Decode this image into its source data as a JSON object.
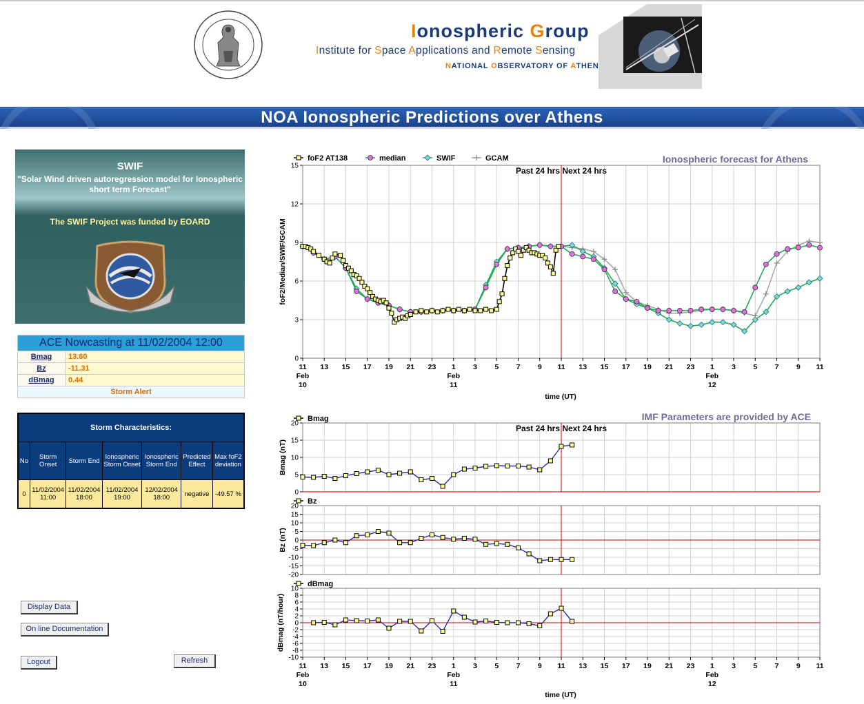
{
  "header": {
    "title_first": "I",
    "title_rest_1": "onospheric ",
    "title_second": "G",
    "title_rest_2": "roup",
    "sub_1": "I",
    "sub_2": "nstitute for ",
    "sub_3": "S",
    "sub_4": "pace ",
    "sub_5": "A",
    "sub_6": "pplications and ",
    "sub_7": "R",
    "sub_8": "emote ",
    "sub_9": "S",
    "sub_10": "ensing",
    "noa_1": "N",
    "noa_2": "ATIONAL ",
    "noa_3": "O",
    "noa_4": "BSERVATORY OF ",
    "noa_5": "A",
    "noa_6": "THENS",
    "seal_text": "ΕΘΝΙΚΟΝ ΑΣΤΕΡΟΣΚΟΠΕΙΟΝ ΑΘΗΝΩΝ · NATIONAL OBSERVATORY ATHENS"
  },
  "banner": {
    "title": "NOA Ionospheric Predictions over Athens"
  },
  "swif": {
    "title": "SWIF",
    "subtitle_1": "\"Solar Wind driven autoregression model for Ionospheric",
    "subtitle_2": "short term Forecast\"",
    "funded": "The SWIF Project was funded by EOARD",
    "badge_text": "EUROPEAN OFFICE AEROSPACE R&D"
  },
  "ace": {
    "title": "ACE Nowcasting at 11/02/2004 12:00",
    "rows": [
      {
        "key": "Bmag",
        "value": "13.60"
      },
      {
        "key": "Bz",
        "value": "-11.31"
      },
      {
        "key": "dBmag",
        "value": "0.44"
      }
    ],
    "alert": "Storm Alert"
  },
  "storm": {
    "title": "Storm Characteristics:",
    "headers": [
      "No",
      "Storm Onset",
      "Storm End",
      "Ionospheric Storm Onset",
      "Ionospheric Storm End",
      "Predicted Effect",
      "Max foF2 deviation"
    ],
    "row": [
      "0",
      "11/02/2004 11:00",
      "11/02/2004 18:00",
      "11/02/2004 19:00",
      "12/02/2004 18:00",
      "negative",
      "-49.57 %"
    ]
  },
  "buttons": {
    "display_data": "Display Data",
    "online_doc": "On line Documentation",
    "logout": "Logout",
    "refresh": "Refresh"
  },
  "colors": {
    "banner": "#1f4f9e",
    "ace_head": "#2c9fd9",
    "storm_head": "#0b3d7e",
    "storm_cell": "#fce99c",
    "chart_title": "#6b6b9a",
    "median": "#e070e0",
    "swif": "#22aa55",
    "gcam": "#a8a8a8",
    "imf_line": "#2c2cb4",
    "now_line": "#cc0000"
  },
  "chart_data": [
    {
      "type": "line",
      "title": "Ionospheric forecast for Athens",
      "ylabel": "foF2/Median/SWIF/GCAM",
      "xlabel": "time (UT)",
      "annotation": "Past 24 hrs Next 24 hrs",
      "ylim": [
        0,
        15
      ],
      "yticks": [
        "0",
        "3",
        "6",
        "9",
        "12",
        "15"
      ],
      "xticks": [
        "11",
        "13",
        "15",
        "17",
        "19",
        "21",
        "23",
        "1",
        "3",
        "5",
        "7",
        "9",
        "11",
        "13",
        "15",
        "17",
        "19",
        "21",
        "23",
        "1",
        "3",
        "5",
        "7",
        "9",
        "11"
      ],
      "date_labels": [
        {
          "month": "Feb",
          "day": "10"
        },
        {
          "month": "Feb",
          "day": "11"
        },
        {
          "month": "Feb",
          "day": "12"
        }
      ],
      "grid": true,
      "legend": "top-left",
      "x_range_hours": [
        0,
        48
      ],
      "now_hour": 24,
      "series": [
        {
          "name": "foF2 AT138",
          "x": [
            0,
            0.25,
            0.5,
            0.75,
            1,
            1.5,
            2,
            2.25,
            2.5,
            2.75,
            3,
            3.5,
            3.75,
            4,
            4.25,
            4.5,
            4.75,
            5,
            5.25,
            5.5,
            5.75,
            6,
            6.25,
            6.5,
            6.75,
            7,
            7.25,
            7.5,
            7.75,
            8,
            8.25,
            8.5,
            8.75,
            9,
            9.25,
            9.5,
            9.75,
            10,
            10.5,
            11,
            11.5,
            12,
            12.5,
            13,
            13.5,
            14,
            14.5,
            15,
            15.5,
            16,
            16.5,
            17,
            17.5,
            18,
            18.25,
            18.5,
            18.75,
            19,
            19.25,
            19.5,
            19.75,
            20,
            20.25,
            20.5,
            20.75,
            21,
            21.25,
            21.5,
            21.75,
            22,
            22.25,
            22.5,
            22.75,
            23,
            23.25,
            23.5,
            23.75
          ],
          "values": [
            8.7,
            8.7,
            8.6,
            8.5,
            8.3,
            8.0,
            7.7,
            7.5,
            7.4,
            7.8,
            8.1,
            8.0,
            7.6,
            7.2,
            7.0,
            6.8,
            6.5,
            6.4,
            6.2,
            5.9,
            5.6,
            5.4,
            5.1,
            4.8,
            4.6,
            4.5,
            4.4,
            4.5,
            4.3,
            3.9,
            3.5,
            2.8,
            3.0,
            3.1,
            3.2,
            3.1,
            3.3,
            3.4,
            3.6,
            3.7,
            3.6,
            3.7,
            3.6,
            3.7,
            3.8,
            3.7,
            3.8,
            3.7,
            3.8,
            3.7,
            3.7,
            3.8,
            3.7,
            3.8,
            4.4,
            5.0,
            6.2,
            7.2,
            7.8,
            8.2,
            8.5,
            8.3,
            8.0,
            8.4,
            8.6,
            8.4,
            8.2,
            8.2,
            8.1,
            8.0,
            8.0,
            7.8,
            7.4,
            7.1,
            6.6,
            8.4,
            8.7
          ]
        },
        {
          "name": "median",
          "x": [
            0,
            1,
            2,
            3,
            4,
            5,
            6,
            7,
            8,
            9,
            10,
            11,
            12,
            13,
            14,
            15,
            16,
            17,
            18,
            19,
            20,
            21,
            22,
            23,
            24,
            25,
            26,
            27,
            28,
            29,
            30,
            31,
            32,
            33,
            34,
            35,
            36,
            37,
            38,
            39,
            40,
            41,
            42,
            43,
            44,
            45,
            46,
            47,
            48
          ],
          "values": [
            8.7,
            8.2,
            7.7,
            7.9,
            7.0,
            5.2,
            4.6,
            4.3,
            4.1,
            3.8,
            3.6,
            3.6,
            3.7,
            3.7,
            3.7,
            3.7,
            3.8,
            5.5,
            7.3,
            8.5,
            8.6,
            8.7,
            8.8,
            8.7,
            8.7,
            8.1,
            7.9,
            7.7,
            6.9,
            5.2,
            4.6,
            4.4,
            3.9,
            3.7,
            3.7,
            3.7,
            3.7,
            3.8,
            3.8,
            3.8,
            3.7,
            3.6,
            5.5,
            7.3,
            8.1,
            8.5,
            8.6,
            8.8,
            8.6
          ]
        },
        {
          "name": "SWIF",
          "x": [
            0,
            1,
            2,
            3,
            4,
            5,
            6,
            7,
            8,
            9,
            10,
            11,
            12,
            13,
            14,
            15,
            16,
            17,
            18,
            19,
            20,
            21,
            22,
            23,
            24,
            25,
            26,
            27,
            28,
            29,
            30,
            31,
            32,
            33,
            34,
            35,
            36,
            37,
            38,
            39,
            40,
            41,
            42,
            43,
            44,
            45,
            46,
            47,
            48
          ],
          "values": [
            8.7,
            8.2,
            7.7,
            7.9,
            7.0,
            5.4,
            4.6,
            4.4,
            4.1,
            3.8,
            3.6,
            3.6,
            3.7,
            3.7,
            3.7,
            3.7,
            3.8,
            5.7,
            7.5,
            8.5,
            8.6,
            8.7,
            8.8,
            8.7,
            8.7,
            8.8,
            8.3,
            7.9,
            7.0,
            5.8,
            4.6,
            4.2,
            3.9,
            3.5,
            3.0,
            2.7,
            2.5,
            2.6,
            2.8,
            2.8,
            2.6,
            2.1,
            3.0,
            3.6,
            4.8,
            5.2,
            5.5,
            5.9,
            6.2
          ]
        },
        {
          "name": "GCAM",
          "x": [
            22,
            23,
            24,
            25,
            26,
            27,
            28,
            29,
            30,
            31,
            32,
            33,
            34,
            35,
            36,
            37,
            38,
            39,
            40,
            41,
            42,
            43,
            44,
            45,
            46,
            47,
            48
          ],
          "values": [
            8.8,
            8.7,
            8.7,
            8.6,
            8.5,
            8.3,
            7.7,
            6.9,
            5.1,
            4.4,
            4.1,
            3.8,
            3.5,
            3.5,
            3.6,
            3.7,
            3.8,
            3.8,
            3.7,
            3.5,
            3.3,
            5.0,
            7.4,
            8.3,
            8.8,
            9.1,
            9.0
          ]
        }
      ]
    },
    {
      "type": "line",
      "title": "IMF Parameters are provided by ACE",
      "ylabel": "Bmag (nT)",
      "annotation": "Past 24 hrs Next 24 hrs",
      "ylim": [
        0,
        20
      ],
      "yticks": [
        "0",
        "5",
        "10",
        "15",
        "20"
      ],
      "series": [
        {
          "name": "Bmag",
          "x": [
            0,
            1,
            2,
            3,
            4,
            5,
            6,
            7,
            8,
            9,
            10,
            11,
            12,
            13,
            14,
            15,
            16,
            17,
            18,
            19,
            20,
            21,
            22,
            23,
            24,
            25
          ],
          "values": [
            4.3,
            4.2,
            4.5,
            3.9,
            4.7,
            5.3,
            5.8,
            6.3,
            5.0,
            5.4,
            5.8,
            3.5,
            3.9,
            1.6,
            5.0,
            6.6,
            6.9,
            7.4,
            7.6,
            7.5,
            7.5,
            7.2,
            6.4,
            9.0,
            13.2,
            13.6
          ]
        }
      ]
    },
    {
      "type": "line",
      "ylabel": "Bz (nT)",
      "ylim": [
        -20,
        20
      ],
      "yticks": [
        "-20",
        "-15",
        "-10",
        "-5",
        "0",
        "5",
        "10",
        "15",
        "20"
      ],
      "series": [
        {
          "name": "Bz",
          "x": [
            0,
            1,
            2,
            3,
            4,
            5,
            6,
            7,
            8,
            9,
            10,
            11,
            12,
            13,
            14,
            15,
            16,
            17,
            18,
            19,
            20,
            21,
            22,
            23,
            24,
            25
          ],
          "values": [
            -3.0,
            -3.2,
            -1.5,
            0.0,
            -1.5,
            2.5,
            3.0,
            5.0,
            4.0,
            -1.5,
            -1.5,
            1.0,
            3.0,
            1.5,
            0.5,
            1.0,
            0.5,
            -2.5,
            -2.0,
            -2.5,
            -4.5,
            -8.0,
            -12.0,
            -11.3,
            -11.3,
            -11.3
          ]
        }
      ]
    },
    {
      "type": "line",
      "ylabel": "dBmag (nT/hour)",
      "xlabel": "time (UT)",
      "ylim": [
        -10,
        10
      ],
      "yticks": [
        "-10",
        "-8",
        "-6",
        "-4",
        "-2",
        "0",
        "2",
        "4",
        "6",
        "8",
        "10"
      ],
      "series": [
        {
          "name": "dBmag",
          "x": [
            1,
            2,
            3,
            4,
            5,
            6,
            7,
            8,
            9,
            10,
            11,
            12,
            13,
            14,
            15,
            16,
            17,
            18,
            19,
            20,
            21,
            22,
            23,
            24,
            25
          ],
          "values": [
            0.0,
            0.1,
            -0.6,
            0.8,
            0.6,
            0.5,
            0.8,
            -1.6,
            0.4,
            0.4,
            -2.4,
            0.6,
            -2.5,
            3.4,
            1.6,
            0.2,
            0.5,
            0.1,
            0.0,
            0.0,
            -0.3,
            -0.9,
            2.6,
            4.2,
            0.4
          ]
        }
      ]
    }
  ]
}
